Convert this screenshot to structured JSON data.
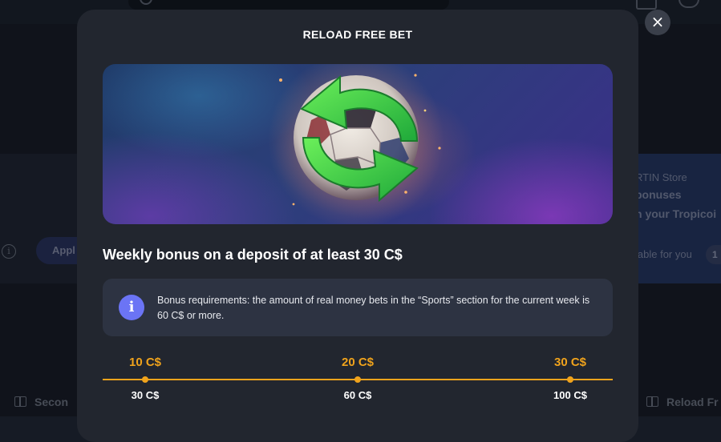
{
  "background": {
    "apply_label": "Appl",
    "store_line1": "RTIN Store",
    "store_line2": "bonuses",
    "store_line3": "n your Tropicoi",
    "available_label": "lable for you",
    "available_count": "1",
    "bottom_left_label": "Secon",
    "bottom_right_label": "Reload Fr"
  },
  "modal": {
    "title": "RELOAD FREE BET",
    "close_symbol": "×",
    "banner_image": "soccer-ball-with-green-reload-arrows",
    "headline": "Weekly bonus on a deposit of at least 30 C$",
    "requirements": {
      "icon": "i",
      "text": "Bonus requirements: the amount of real money bets in the “Sports” section for the current week is 60 C$ or more."
    },
    "tiers": [
      {
        "bonus": "10 C$",
        "deposit": "30 C$"
      },
      {
        "bonus": "20 C$",
        "deposit": "60 C$"
      },
      {
        "bonus": "30 C$",
        "deposit": "100 C$"
      }
    ]
  },
  "colors": {
    "accent": "#f0a31c",
    "info": "#6b74f5",
    "modal_bg": "#22262f"
  }
}
